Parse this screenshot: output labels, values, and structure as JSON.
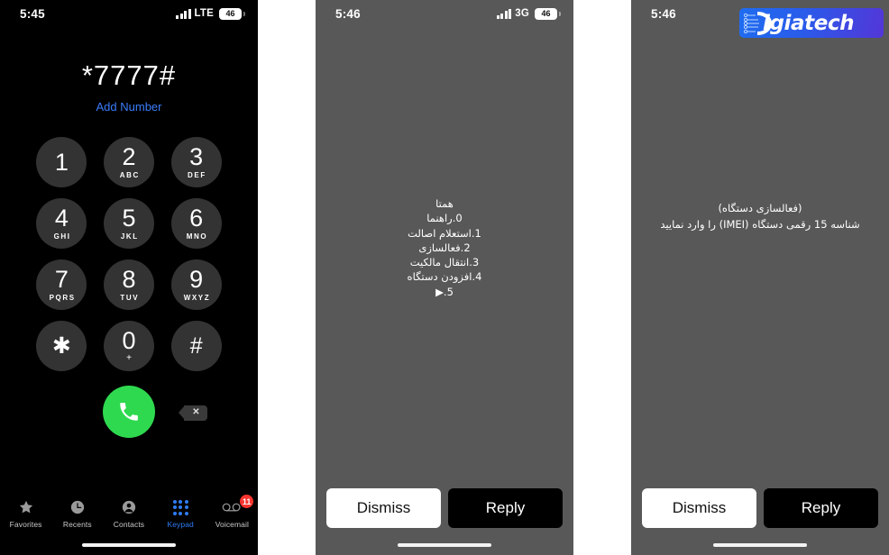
{
  "panels": {
    "dialer": {
      "status": {
        "time": "5:45",
        "network": "LTE",
        "battery": "46"
      },
      "dialed_number": "*7777#",
      "add_number_label": "Add Number",
      "keys": [
        {
          "digit": "1",
          "letters": ""
        },
        {
          "digit": "2",
          "letters": "ABC"
        },
        {
          "digit": "3",
          "letters": "DEF"
        },
        {
          "digit": "4",
          "letters": "GHI"
        },
        {
          "digit": "5",
          "letters": "JKL"
        },
        {
          "digit": "6",
          "letters": "MNO"
        },
        {
          "digit": "7",
          "letters": "PQRS"
        },
        {
          "digit": "8",
          "letters": "TUV"
        },
        {
          "digit": "9",
          "letters": "WXYZ"
        },
        {
          "digit": "✱",
          "letters": ""
        },
        {
          "digit": "0",
          "letters": "+"
        },
        {
          "digit": "#",
          "letters": ""
        }
      ],
      "call_icon": "phone-icon",
      "backspace_icon": "backspace-icon",
      "tabs": [
        {
          "label": "Favorites",
          "icon": "star-icon",
          "active": false,
          "badge": ""
        },
        {
          "label": "Recents",
          "icon": "clock-icon",
          "active": false,
          "badge": ""
        },
        {
          "label": "Contacts",
          "icon": "person-circle-icon",
          "active": false,
          "badge": ""
        },
        {
          "label": "Keypad",
          "icon": "keypad-dots-icon",
          "active": true,
          "badge": ""
        },
        {
          "label": "Voicemail",
          "icon": "voicemail-icon",
          "active": false,
          "badge": "11"
        }
      ]
    },
    "ussd_menu": {
      "status": {
        "time": "5:46",
        "network": "3G",
        "battery": "46"
      },
      "lines": [
        "همتا",
        "0.راهنما",
        "1.استعلام اصالت",
        "2.فعالسازی",
        "3.انتقال مالکیت",
        "4.افزودن دستگاه",
        "5.▶"
      ],
      "dismiss_label": "Dismiss",
      "reply_label": "Reply"
    },
    "ussd_imei": {
      "status": {
        "time": "5:46",
        "network": "",
        "battery": ""
      },
      "lines": [
        "(فعالسازی دستگاه)",
        "شناسه 15 رقمی دستگاه (IMEI) را وارد نمایید"
      ],
      "dismiss_label": "Dismiss",
      "reply_label": "Reply"
    }
  },
  "watermark": {
    "brand": "igiatech",
    "brand_initial": "D",
    "colors": {
      "start": "#1f6df0",
      "end": "#5336d8"
    }
  },
  "colors": {
    "dialer_bg": "#000000",
    "dialog_bg": "#585858",
    "accent_blue": "#3b7dfb",
    "call_green": "#2ed94f",
    "badge_red": "#f8352f"
  }
}
